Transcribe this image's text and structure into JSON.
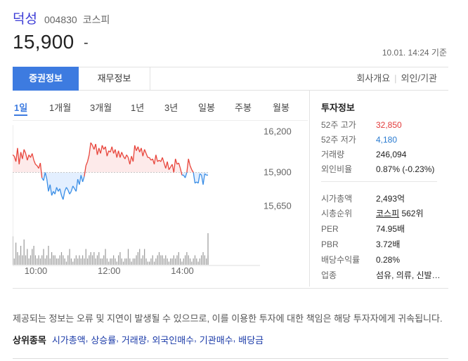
{
  "header": {
    "company_name": "덕성",
    "stock_code": "004830",
    "market": "코스피",
    "price": "15,900",
    "change": "-",
    "as_of": "10.01. 14:24 기준"
  },
  "tabs": {
    "active": "증권정보",
    "second": "재무정보",
    "right": [
      "회사개요",
      "외인/기관"
    ]
  },
  "periods": [
    "1일",
    "1개월",
    "3개월",
    "1년",
    "3년",
    "일봉",
    "주봉",
    "월봉"
  ],
  "chart_data": {
    "type": "line",
    "x_ticks": [
      "10:00",
      "12:00",
      "14:00"
    ],
    "y_ticks": [
      "16,200",
      "15,900",
      "15,650"
    ],
    "ylim": [
      15550,
      16250
    ],
    "baseline": 15900,
    "colors": {
      "above": "#e8453c",
      "below": "#3a8ee6",
      "fill_above": "#fdeaea",
      "fill_below": "#e3efff"
    },
    "series": [
      {
        "values": [
          16030,
          16020,
          15980,
          16080,
          15960,
          16050,
          16000,
          16070,
          16040,
          15990,
          16030,
          16010,
          16040,
          15990,
          15960,
          15950,
          15930,
          15970,
          15860,
          15840,
          15900,
          15850,
          15760,
          15810,
          15730,
          15760,
          15740,
          15790,
          15760,
          15780,
          15730,
          15700,
          15760,
          15790,
          15770,
          15740,
          15760,
          15800,
          15780,
          15760,
          15850,
          15810,
          15880,
          15830,
          15870,
          15950,
          15980,
          16030,
          16120,
          16100,
          16070,
          16110,
          16030,
          16080,
          16040,
          16100,
          16070,
          16090,
          16020,
          16060,
          16050,
          16090,
          16040,
          16070,
          16010,
          16060,
          16010,
          16050,
          16020,
          16000,
          16030,
          16010,
          15960,
          16020,
          15980,
          16100,
          16060,
          16090,
          16050,
          16080,
          16020,
          16070,
          16040,
          16010,
          16010,
          15990,
          16000,
          15960,
          16030,
          15980,
          15990,
          15980,
          16010,
          15970,
          15930,
          15980,
          15920,
          15940,
          15960,
          15900,
          16000,
          15960,
          15970,
          15930,
          15880,
          15880,
          15860,
          15900,
          16000,
          15950,
          15920,
          15900,
          15820,
          15830,
          15820,
          15890,
          15880,
          15810,
          15890,
          15880,
          15880
        ]
      }
    ],
    "volume": [
      9,
      2,
      7,
      4,
      3,
      6,
      3,
      8,
      3,
      5,
      2,
      3,
      5,
      6,
      3,
      2,
      3,
      2,
      3,
      5,
      2,
      3,
      6,
      2,
      4,
      3,
      3,
      2,
      2,
      3,
      4,
      3,
      2,
      1,
      3,
      5,
      2,
      1,
      2,
      3,
      2,
      3,
      2,
      3,
      2,
      5,
      2,
      3,
      4,
      3,
      4,
      2,
      3,
      4,
      2,
      2,
      3,
      5,
      2,
      1,
      2,
      2,
      3,
      2,
      1,
      3,
      4,
      2,
      1,
      2,
      2,
      5,
      2,
      1,
      2,
      2,
      3,
      4,
      5,
      2,
      3,
      5,
      2,
      1,
      1,
      2,
      3,
      1,
      2,
      3,
      4,
      3,
      3,
      2,
      3,
      2,
      1,
      2,
      2,
      3,
      2,
      3,
      4,
      2,
      1,
      2,
      3,
      4,
      3,
      2,
      1,
      2,
      3,
      2,
      1,
      2,
      3,
      4,
      3,
      2,
      10,
      3
    ]
  },
  "info": {
    "title": "투자정보",
    "rows": [
      {
        "label": "52주 고가",
        "value": "32,850",
        "tone": "up"
      },
      {
        "label": "52주 저가",
        "value": "4,180",
        "tone": "down"
      },
      {
        "label": "거래량",
        "value": "246,094"
      },
      {
        "label": "외인비율",
        "value": "0.87% (-0.23%)"
      },
      {
        "label": "시가총액",
        "value": "2,493억"
      },
      {
        "label": "시총순위",
        "value_link": "코스피",
        "value_rest": " 562위"
      },
      {
        "label": "PER",
        "value": "74.95배"
      },
      {
        "label": "PBR",
        "value": "3.72배"
      },
      {
        "label": "배당수익률",
        "value": "0.28%"
      },
      {
        "label": "업종",
        "value": "섬유, 의류, 신발…",
        "tone": "link"
      }
    ]
  },
  "footer": {
    "disclaimer": "제공되는 정보는 오류 및 지연이 발생될 수 있으므로, 이를 이용한 투자에 대한 책임은 해당 투자자에게 귀속됩니다.",
    "related_head": "상위종목",
    "related": [
      "시가총액",
      "상승률",
      "거래량",
      "외국인매수",
      "기관매수",
      "배당금"
    ]
  }
}
